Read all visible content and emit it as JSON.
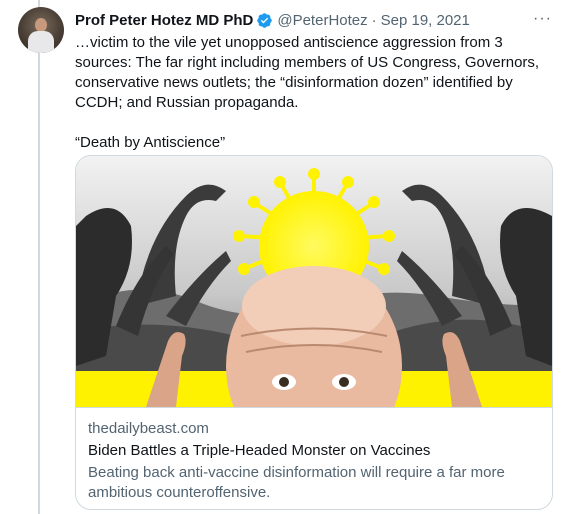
{
  "author": {
    "name": "Prof Peter Hotez MD PhD",
    "handle": "@PeterHotez",
    "separator": "·",
    "date": "Sep 19, 2021"
  },
  "more_label": "···",
  "tweet": {
    "body": "…victim to the vile yet unopposed antiscience aggression from 3 sources: The far right including members of US Congress, Governors, conservative news outlets; the “disinformation dozen” identified by CCDH; and Russian propaganda.",
    "quote": "“Death by Antiscience”"
  },
  "link_card": {
    "domain": "thedailybeast.com",
    "title": "Biden Battles a Triple-Headed Monster on Vaccines",
    "description": "Beating back anti-vaccine disinformation will require a far more ambitious counteroffensive."
  },
  "colors": {
    "text_primary": "#0f1419",
    "text_secondary": "#536471",
    "verified_blue": "#1d9bf0",
    "border": "#cfd9de",
    "illustration_yellow": "#fff200"
  },
  "icons": {
    "verified": "verified-badge-icon",
    "more": "more-options-icon"
  }
}
